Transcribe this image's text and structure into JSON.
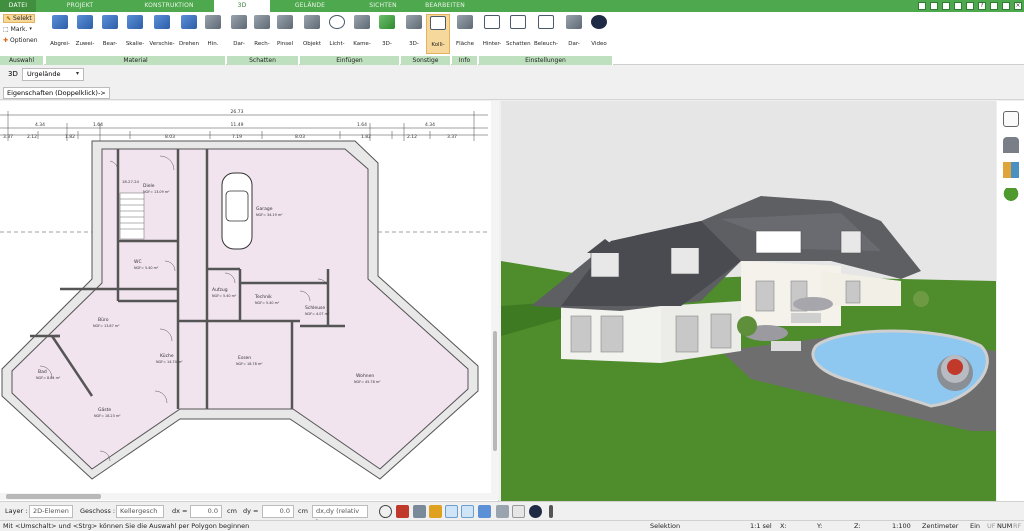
{
  "tabs": [
    {
      "label": "DATEI"
    },
    {
      "label": "PROJEKT"
    },
    {
      "label": "KONSTRUKTION"
    },
    {
      "label": "3D"
    },
    {
      "label": "GELÄNDE"
    },
    {
      "label": "SICHTEN"
    },
    {
      "label": "BEARBEITEN"
    }
  ],
  "active_tab": "3D",
  "selection_group": {
    "select": "Selekt",
    "mark": "Mark.",
    "options": "Optionen",
    "label": "Auswahl"
  },
  "groups": {
    "material": {
      "label": "Material",
      "buttons": [
        "Abgrei-\nfen",
        "Zuwei-\nsen",
        "Bear-\nbeiten",
        "Skalie-\nren",
        "Verschie-\nben",
        "Drehen",
        "Hin.\nPinsel"
      ]
    },
    "shadows": {
      "label": "Schatten",
      "buttons": [
        "Dar-\nstellen",
        "Rech-\nnen",
        "Pinsel"
      ]
    },
    "insert": {
      "label": "Einfügen",
      "buttons": [
        "Objekt",
        "Licht-\nquelle",
        "Kame-\nra",
        "3D-\nBitmap"
      ]
    },
    "misc": {
      "label": "Sonstige",
      "buttons": [
        "3D-\nSchnitt",
        "Kolli-\nsion"
      ]
    },
    "info": {
      "label": "Info",
      "buttons": [
        "Fläche"
      ]
    },
    "settings": {
      "label": "Einstellungen",
      "buttons": [
        "Hinter-\ngrund",
        "Schatten",
        "Beleuch-\ntung",
        "Dar-\nstellung",
        "Video"
      ]
    }
  },
  "viewbar": {
    "mode": "3D",
    "terrain": "Urgelände"
  },
  "properties_button": "Eigenschaften (Doppelklick)->",
  "plan": {
    "overall_dim": "26.73",
    "dims_row2": [
      "4.34",
      "1.64",
      "11.49",
      "1.64",
      "4.34"
    ],
    "dims_row3": [
      "3.37",
      "2.12",
      "1.82",
      "8.03",
      "7.19",
      "8.03",
      "1.82",
      "2.12",
      "3.37"
    ],
    "rooms": [
      {
        "name": "Diele",
        "area": "NGF= 13.09 m²"
      },
      {
        "name": "Garage",
        "area": "NGF= 34.19 m²"
      },
      {
        "name": "WC",
        "area": "NGF= 5.40 m²"
      },
      {
        "name": "Aufzug",
        "area": "NGF= 5.40 m²"
      },
      {
        "name": "Technik",
        "area": "NGF= 5.40 m²"
      },
      {
        "name": "Schleuse",
        "area": "NGF= 4.07 m²"
      },
      {
        "name": "Büro",
        "area": "NGF= 13.87 m²"
      },
      {
        "name": "Küche",
        "area": "NGF= 14.74 m²"
      },
      {
        "name": "Essen",
        "area": "NGF= 18.78 m²"
      },
      {
        "name": "Wohnen",
        "area": "NGF= 45.78 m²"
      },
      {
        "name": "Bad",
        "area": "NGF= 8.84 m²"
      },
      {
        "name": "Gäste",
        "area": "NGF= 18.23 m²"
      }
    ],
    "stair_label": "18.27.24"
  },
  "bottombar": {
    "layer_label": "Layer :",
    "layer_value": "2D-Elemen",
    "floor_label": "Geschoss :",
    "floor_value": "Kellergesch",
    "dx_label": "dx =",
    "dx_value": "0.0",
    "dx_unit": "cm",
    "dy_label": "dy =",
    "dy_value": "0.0",
    "dy_unit": "cm",
    "mode_value": "dx,dy (relativ ka"
  },
  "statusbar": {
    "hint": "Mit <Umschalt> und <Strg> können Sie die Auswahl per Polygon beginnen",
    "mode": "Selektion",
    "sel": "1:1 sel",
    "x": "X:",
    "y": "Y:",
    "z": "Z:",
    "scale": "1:100",
    "unit": "Zentimeter",
    "ein": "Ein",
    "uf": "UF",
    "num": "NUM",
    "rf": "RF"
  },
  "colors": {
    "accent": "#4ea84e",
    "group_label": "#bfe0bf",
    "room_fill": "#f1e4ef",
    "active_button": "#f7d89c"
  }
}
